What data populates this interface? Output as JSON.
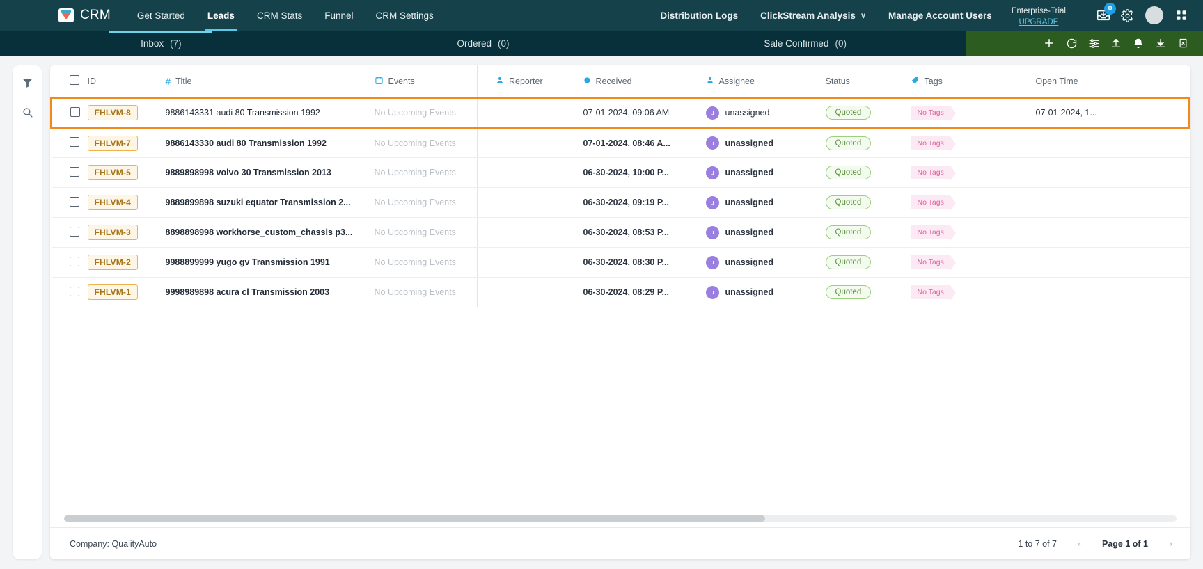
{
  "topnav": {
    "brand": "CRM",
    "brand_logo_icon": "funnel-logo-icon",
    "links": [
      {
        "label": "Get Started",
        "active": false
      },
      {
        "label": "Leads",
        "active": true
      },
      {
        "label": "CRM Stats",
        "active": false
      },
      {
        "label": "Funnel",
        "active": false
      },
      {
        "label": "CRM Settings",
        "active": false
      }
    ],
    "right_links": [
      {
        "label": "Distribution Logs",
        "chevron": false
      },
      {
        "label": "ClickStream Analysis",
        "chevron": true
      },
      {
        "label": "Manage Account Users",
        "chevron": false
      }
    ],
    "chevron_glyph": "∨",
    "trial_label": "Enterprise-Trial",
    "trial_upgrade": "UPGRADE",
    "inbox_badge": "0",
    "icons": {
      "inbox": "inbox-download-icon",
      "settings": "gear-icon",
      "avatar": "user-avatar",
      "apps": "apps-grid-icon"
    },
    "colors": {
      "bar": "#15424a",
      "accent": "#5cc8e8"
    }
  },
  "subbar": {
    "tabs": [
      {
        "label": "Inbox",
        "count": "(7)",
        "active": true
      },
      {
        "label": "Ordered",
        "count": "(0)",
        "active": false
      },
      {
        "label": "Sale Confirmed",
        "count": "(0)",
        "active": false
      }
    ],
    "toolbar_icons": [
      {
        "name": "add-icon",
        "title": "Add"
      },
      {
        "name": "refresh-icon",
        "title": "Refresh"
      },
      {
        "name": "filter-settings-icon",
        "title": "Filters"
      },
      {
        "name": "upload-icon",
        "title": "Upload"
      },
      {
        "name": "bell-icon",
        "title": "Notifications"
      },
      {
        "name": "download-icon",
        "title": "Download"
      },
      {
        "name": "delete-icon",
        "title": "Delete"
      }
    ],
    "colors": {
      "bar": "#07303a",
      "toolbar": "#2d5c20",
      "active_underline": "#6fd2ea"
    }
  },
  "leftrail": {
    "icons": [
      {
        "name": "filter-icon"
      },
      {
        "name": "search-icon"
      }
    ]
  },
  "table": {
    "columns": [
      {
        "key": "checkbox",
        "label": "",
        "icon": "checkbox-icon"
      },
      {
        "key": "id",
        "label": "ID",
        "icon": null
      },
      {
        "key": "title",
        "label": "Title",
        "icon": "hash-icon"
      },
      {
        "key": "events",
        "label": "Events",
        "icon": "calendar-icon"
      },
      {
        "key": "reporter",
        "label": "Reporter",
        "icon": "person-icon"
      },
      {
        "key": "received",
        "label": "Received",
        "icon": "clock-dot-icon"
      },
      {
        "key": "assignee",
        "label": "Assignee",
        "icon": "person-icon"
      },
      {
        "key": "status",
        "label": "Status",
        "icon": null
      },
      {
        "key": "tags",
        "label": "Tags",
        "icon": "tag-icon"
      },
      {
        "key": "open_time",
        "label": "Open Time",
        "icon": null
      }
    ],
    "rows": [
      {
        "id": "FHLVM-8",
        "title": "9886143331 audi 80 Transmission 1992",
        "events": "No Upcoming Events",
        "reporter": "",
        "received": "07-01-2024, 09:06 AM",
        "assignee": "unassigned",
        "assignee_initial": "u",
        "status": "Quoted",
        "tags": "No Tags",
        "open_time": "07-01-2024, 1...",
        "selected": true
      },
      {
        "id": "FHLVM-7",
        "title": "9886143330 audi 80 Transmission 1992",
        "events": "No Upcoming Events",
        "reporter": "",
        "received": "07-01-2024, 08:46 A...",
        "assignee": "unassigned",
        "assignee_initial": "u",
        "status": "Quoted",
        "tags": "No Tags",
        "open_time": "",
        "selected": false
      },
      {
        "id": "FHLVM-5",
        "title": "9889898998 volvo 30 Transmission 2013",
        "events": "No Upcoming Events",
        "reporter": "",
        "received": "06-30-2024, 10:00 P...",
        "assignee": "unassigned",
        "assignee_initial": "u",
        "status": "Quoted",
        "tags": "No Tags",
        "open_time": "",
        "selected": false
      },
      {
        "id": "FHLVM-4",
        "title": "9889899898 suzuki equator Transmission 2...",
        "events": "No Upcoming Events",
        "reporter": "",
        "received": "06-30-2024, 09:19 P...",
        "assignee": "unassigned",
        "assignee_initial": "u",
        "status": "Quoted",
        "tags": "No Tags",
        "open_time": "",
        "selected": false
      },
      {
        "id": "FHLVM-3",
        "title": "8898898998 workhorse_custom_chassis p3...",
        "events": "No Upcoming Events",
        "reporter": "",
        "received": "06-30-2024, 08:53 P...",
        "assignee": "unassigned",
        "assignee_initial": "u",
        "status": "Quoted",
        "tags": "No Tags",
        "open_time": "",
        "selected": false
      },
      {
        "id": "FHLVM-2",
        "title": "9988899999 yugo gv Transmission 1991",
        "events": "No Upcoming Events",
        "reporter": "",
        "received": "06-30-2024, 08:30 P...",
        "assignee": "unassigned",
        "assignee_initial": "u",
        "status": "Quoted",
        "tags": "No Tags",
        "open_time": "",
        "selected": false
      },
      {
        "id": "FHLVM-1",
        "title": "9998989898 acura cl Transmission 2003",
        "events": "No Upcoming Events",
        "reporter": "",
        "received": "06-30-2024, 08:29 P...",
        "assignee": "unassigned",
        "assignee_initial": "u",
        "status": "Quoted",
        "tags": "No Tags",
        "open_time": "",
        "selected": false
      }
    ],
    "selected_row_color": "#f08a1d"
  },
  "footer": {
    "company": "Company: QualityAuto",
    "range": "1 to 7 of 7",
    "page": "Page 1 of 1",
    "prev_glyph": "‹",
    "next_glyph": "›"
  }
}
